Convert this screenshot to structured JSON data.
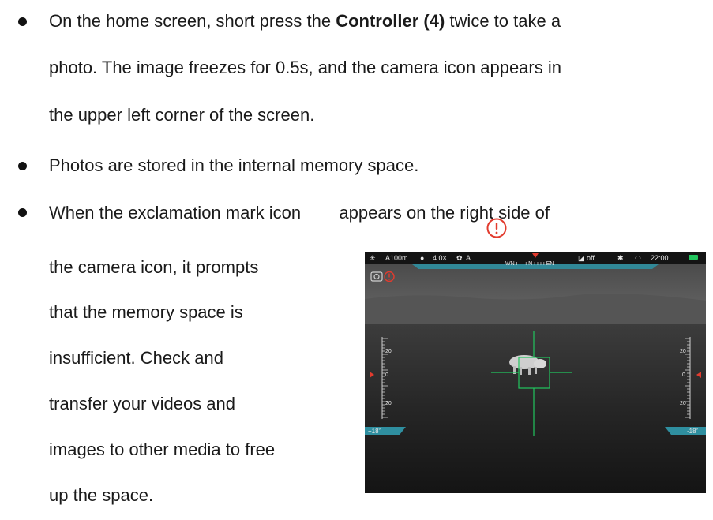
{
  "bullets": [
    {
      "lines": [
        {
          "pre": "On the home screen, short press the ",
          "bold": "Controller (4)",
          "post": " twice to take a"
        },
        {
          "text": "photo. The image freezes for 0.5s, and the camera icon appears in"
        },
        {
          "text": "the upper left corner of the screen."
        }
      ]
    },
    {
      "lines": [
        {
          "text": "Photos are stored in the internal memory space."
        }
      ]
    },
    {
      "lines": [
        {
          "pre": "When the exclamation mark icon ",
          "post": " appears on the right side of"
        },
        {
          "text": "the camera icon, it prompts"
        },
        {
          "text": "that the memory space is"
        },
        {
          "text": "insufficient. Check and"
        },
        {
          "text": "transfer your videos and"
        },
        {
          "text": "images to other media to free"
        },
        {
          "text": "up the space."
        }
      ]
    }
  ],
  "scope_hud": {
    "distance": "A100m",
    "zoom": "4.0×",
    "mode": "A",
    "pip": "off",
    "time": "22:00",
    "compass": "WN  ı ı ı ı  N  ı ı ı ı  EN",
    "left_scale": [
      "20",
      "0",
      "20"
    ],
    "right_scale": [
      "20",
      "0",
      "20"
    ],
    "left_angle": "+18˚",
    "right_angle": "-18˚"
  },
  "colors": {
    "text": "#1a1a1a",
    "warning": "#e23b2e",
    "hud_accent": "#2f8fa0",
    "reticle": "#22c55e"
  }
}
